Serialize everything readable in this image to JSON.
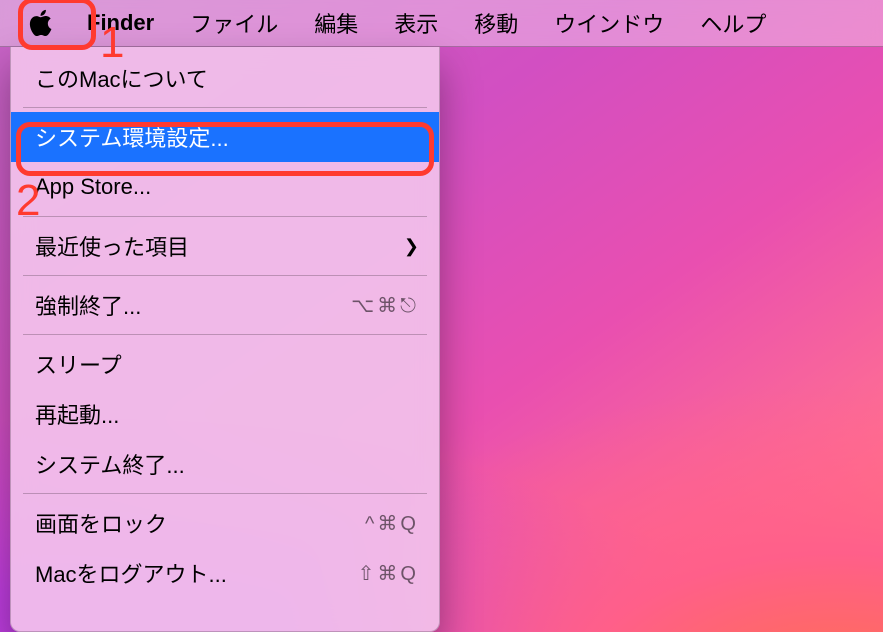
{
  "menubar": {
    "app_name": "Finder",
    "items": [
      "ファイル",
      "編集",
      "表示",
      "移動",
      "ウインドウ",
      "ヘルプ"
    ]
  },
  "apple_menu": {
    "selected_index": 1,
    "items": [
      {
        "label": "このMacについて"
      },
      {
        "label": "システム環境設定...",
        "selected": true
      },
      {
        "label": "App Store..."
      },
      {
        "label": "最近使った項目",
        "has_submenu": true
      },
      {
        "label": "強制終了...",
        "shortcut": "⌥⌘⎋"
      },
      {
        "label": "スリープ"
      },
      {
        "label": "再起動..."
      },
      {
        "label": "システム終了..."
      },
      {
        "label": "画面をロック",
        "shortcut": "^⌘Q"
      },
      {
        "label": "Macをログアウト...",
        "shortcut": "⇧⌘Q"
      }
    ]
  },
  "annotations": [
    {
      "label": "1",
      "target": "apple-menu"
    },
    {
      "label": "2",
      "target": "menu-item-system-prefs"
    }
  ]
}
